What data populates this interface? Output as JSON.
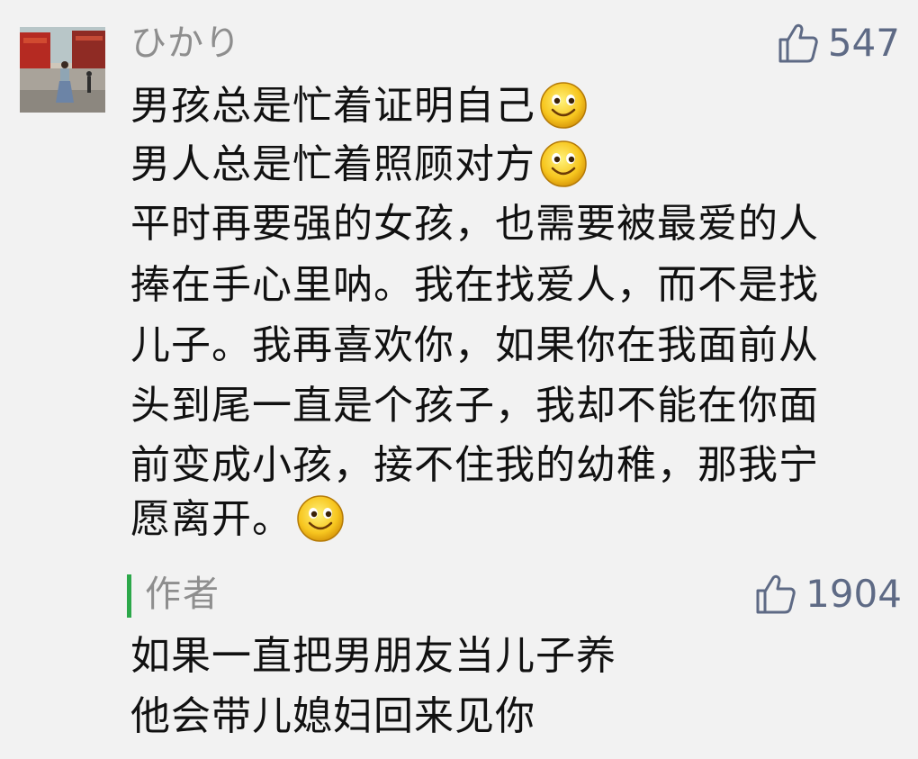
{
  "comment": {
    "nickname": "ひかり",
    "likes": "547",
    "lines": [
      "男孩总是忙着证明自己",
      "男人总是忙着照顾对方",
      "平时再要强的女孩，也需要被最爱的人",
      "捧在手心里呐。我在找爱人，而不是找",
      "儿子。我再喜欢你，如果你在我面前从",
      "头到尾一直是个孩子，我却不能在你面",
      "前变成小孩，接不住我的幼稚，那我宁",
      "愿离开。"
    ]
  },
  "reply": {
    "author_label": "作者",
    "likes": "1904",
    "lines": [
      "如果一直把男朋友当儿子养",
      "他会带儿媳妇回来见你"
    ]
  },
  "icons": {
    "like": "thumbs-up-icon",
    "emoji": "smiley-emoji-icon",
    "avatar": "user-avatar-photo"
  },
  "colors": {
    "background": "#f2f2f2",
    "like_color": "#5e6a85",
    "nickname_color": "#8e8e8e",
    "text_color": "#111111",
    "author_bar": "#2ca84a"
  }
}
